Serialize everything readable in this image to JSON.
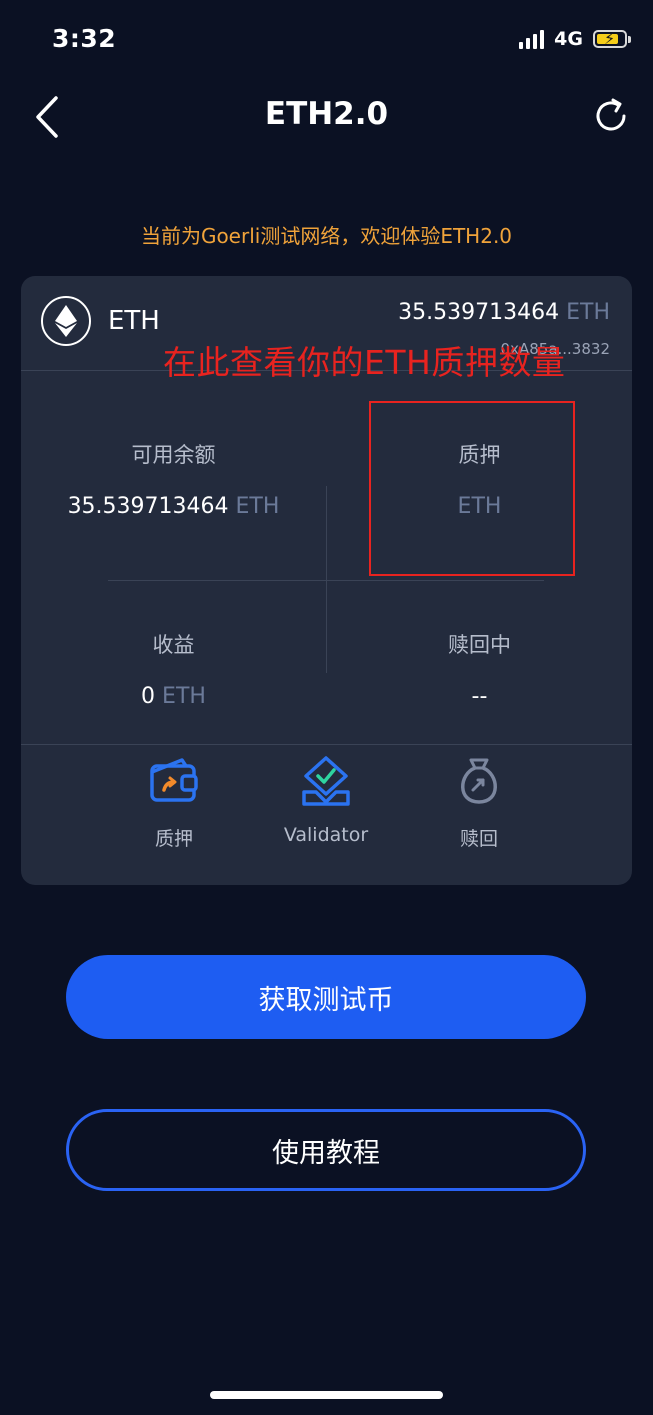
{
  "status_bar": {
    "time": "3:32",
    "network": "4G"
  },
  "nav": {
    "title": "ETH2.0",
    "back_icon": "chevron-left-icon",
    "refresh_icon": "refresh-icon"
  },
  "notice": "当前为Goerli测试网络，欢迎体验ETH2.0",
  "card": {
    "asset_name": "ETH",
    "balance_amount": "35.539713464",
    "balance_unit": "ETH",
    "address": "0xA85a...3832",
    "stats": [
      {
        "label": "可用余额",
        "amount": "35.539713464",
        "unit": "ETH"
      },
      {
        "label": "质押",
        "amount": "",
        "unit": "ETH"
      },
      {
        "label": "收益",
        "amount": "0",
        "unit": "ETH"
      },
      {
        "label": "赎回中",
        "amount": "--",
        "unit": ""
      }
    ],
    "actions": [
      {
        "label": "质押",
        "icon": "wallet-icon"
      },
      {
        "label": "Validator",
        "icon": "validator-icon"
      },
      {
        "label": "赎回",
        "icon": "money-bag-icon"
      }
    ]
  },
  "annotation": {
    "text": "在此查看你的ETH质押数量",
    "color": "#e8231f"
  },
  "buttons": {
    "get_test_coin": "获取测试币",
    "tutorial": "使用教程"
  },
  "colors": {
    "background": "#0b1123",
    "card": "#232b3d",
    "accent": "#1e5df2",
    "notice": "#f0a33a",
    "annotation": "#e8231f"
  }
}
